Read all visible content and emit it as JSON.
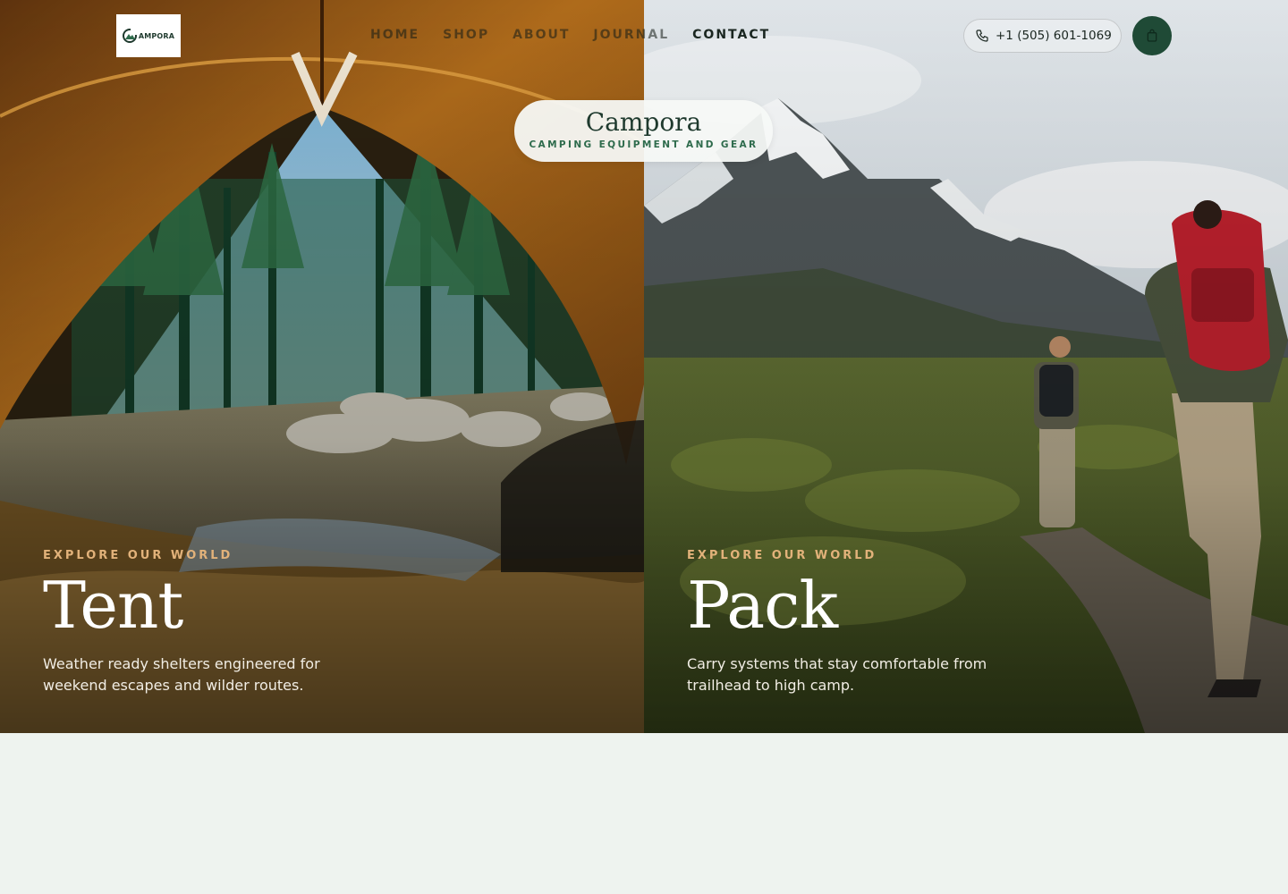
{
  "nav": {
    "logo_text": "AMPORA",
    "logo_letter": "C",
    "items": [
      {
        "label": "HOME"
      },
      {
        "label": "SHOP"
      },
      {
        "label": "ABOUT"
      },
      {
        "label": "JOURNAL"
      },
      {
        "label": "CONTACT"
      }
    ],
    "phone": "+1 (505) 601-1069",
    "icons": {
      "phone": "phone-icon",
      "cart": "shopping-bag-icon"
    }
  },
  "brand": {
    "name": "Campora",
    "tagline": "CAMPING EQUIPMENT AND GEAR"
  },
  "hero": {
    "left": {
      "eyebrow": "EXPLORE OUR WORLD",
      "title": "Tent",
      "description": "Weather ready shelters engineered for weekend escapes and wilder routes."
    },
    "right": {
      "eyebrow": "EXPLORE OUR WORLD",
      "title": "Pack",
      "description": "Carry systems that stay comfortable from trailhead to high camp."
    }
  },
  "colors": {
    "page_bg": "#eef3ef",
    "brand_green": "#1f4a36",
    "eyebrow_gold": "#e2b27a",
    "tagline_green": "#2e6b4c"
  }
}
